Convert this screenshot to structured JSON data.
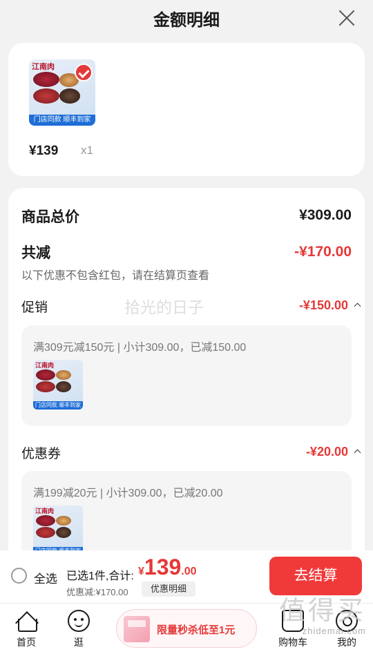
{
  "header": {
    "title": "金额明细"
  },
  "product": {
    "thumb_logo": "江南肉",
    "thumb_strip": "门店同款 顺丰到家",
    "price": "¥139",
    "qty": "x1"
  },
  "summary": {
    "total_label": "商品总价",
    "total_value": "¥309.00",
    "discount_label": "共减",
    "discount_value": "-¥170.00",
    "note": "以下优惠不包含红包，请在结算页查看"
  },
  "watermark": "拾光的日子",
  "sections": [
    {
      "label": "促销",
      "value": "-¥150.00",
      "detail": "满309元减150元 | 小计309.00，已减150.00",
      "thumb_logo": "江南肉",
      "thumb_strip": "门店同款 顺丰到家"
    },
    {
      "label": "优惠券",
      "value": "-¥20.00",
      "detail": "满199减20元 | 小计309.00，已减20.00",
      "thumb_logo": "江南肉",
      "thumb_strip": "门店同款 顺丰到家"
    }
  ],
  "checkout": {
    "select_all": "全选",
    "selected": "已选1件,合计:",
    "currency": "¥",
    "amount_int": "139",
    "amount_dec": ".00",
    "discount": "优惠减:¥170.00",
    "detail_button": "优惠明细",
    "go_button": "去结算"
  },
  "tabbar": {
    "home": "首页",
    "browse": "逛",
    "promo": "限量秒杀低至1元",
    "cart": "购物车",
    "me": "我的"
  },
  "site_watermark": {
    "big": "值得买",
    "small": "zhidemai.com"
  },
  "colors": {
    "accent": "#e53838",
    "button": "#f03a3a",
    "background": "#f2f2f2"
  }
}
